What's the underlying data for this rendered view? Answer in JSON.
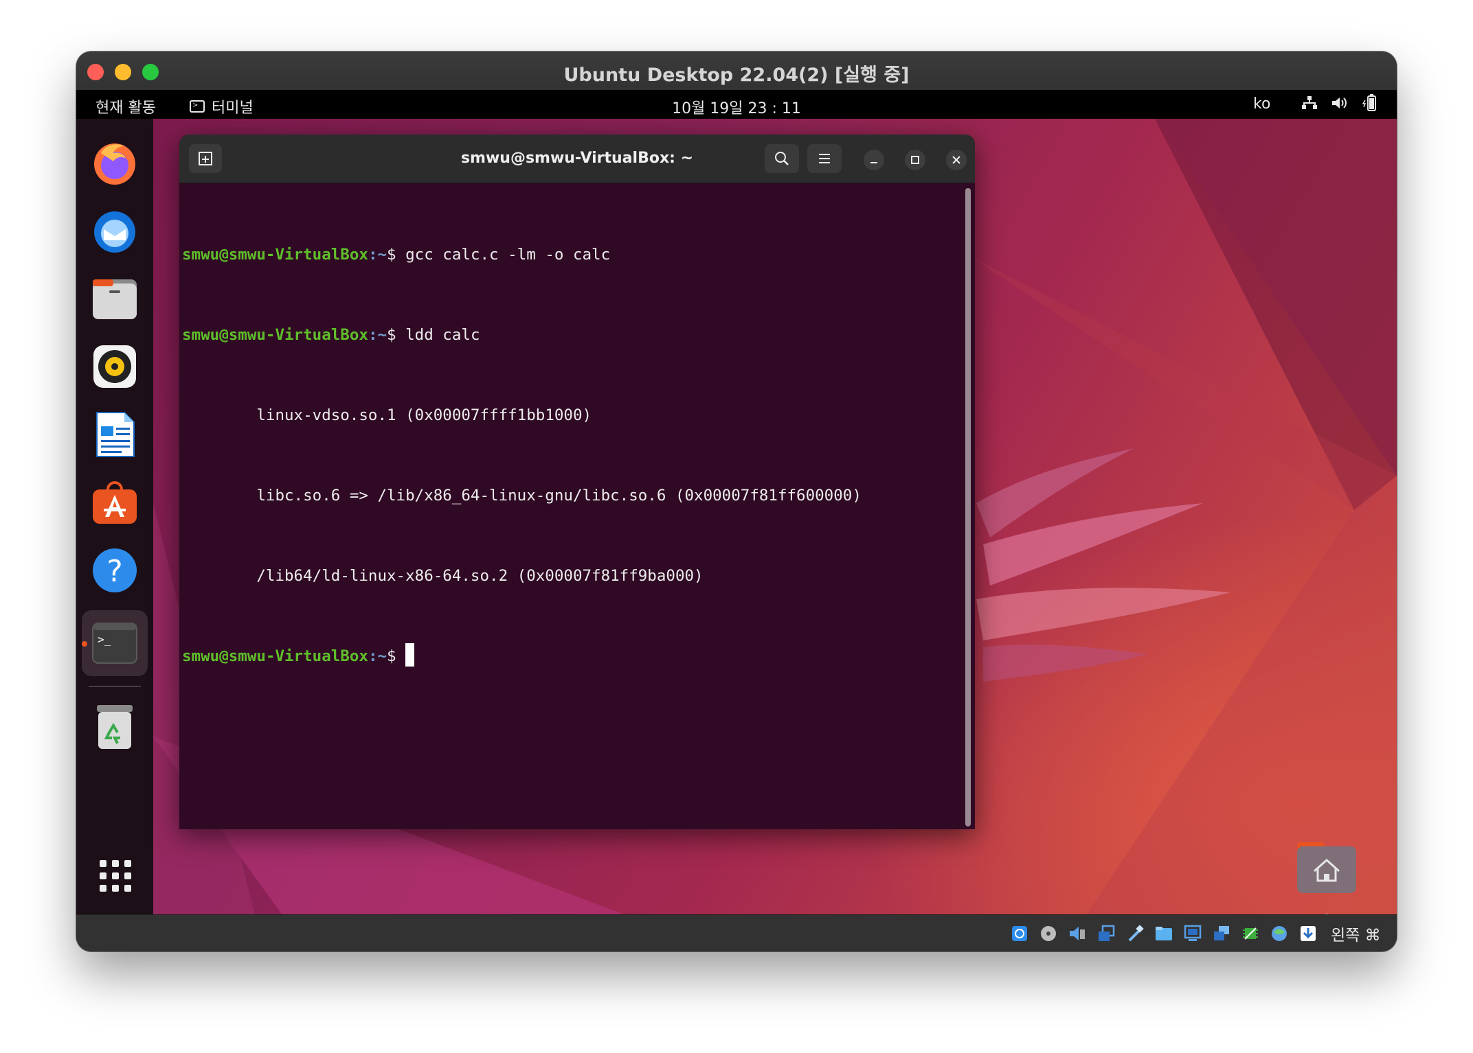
{
  "vm_window": {
    "title": "Ubuntu Desktop 22.04(2) [실행 중]"
  },
  "top_bar": {
    "activities": "현재 활동",
    "app_name": "터미널",
    "clock": "10월 19일  23 : 11",
    "input_lang": "ko"
  },
  "dock": {
    "items": [
      "firefox-icon",
      "thunderbird-icon",
      "files-icon",
      "rhythmbox-icon",
      "writer-icon",
      "software-icon",
      "help-icon",
      "terminal-icon",
      "trash-icon",
      "show-apps-icon"
    ]
  },
  "terminal": {
    "title": "smwu@smwu-VirtualBox: ~",
    "prompt_user": "smwu@smwu-VirtualBox",
    "prompt_path": ":~",
    "prompt_symbol": "$ ",
    "lines": [
      {
        "type": "cmd",
        "text": "gcc calc.c -lm -o calc"
      },
      {
        "type": "cmd",
        "text": "ldd calc"
      },
      {
        "type": "out",
        "text": "        linux-vdso.so.1 (0x00007ffff1bb1000)"
      },
      {
        "type": "out",
        "text": "        libc.so.6 => /lib/x86_64-linux-gnu/libc.so.6 (0x00007f81ff600000)"
      },
      {
        "type": "out",
        "text": "        /lib64/ld-linux-x86-64.so.2 (0x00007f81ff9ba000)"
      },
      {
        "type": "cmd",
        "text": ""
      }
    ]
  },
  "desktop": {
    "home_label": "홈"
  },
  "status_bar": {
    "host_key": "왼쪽 ⌘"
  },
  "colors": {
    "terminal_bg": "#300a24",
    "prompt_user": "#5fbf2a",
    "prompt_path": "#729fcf",
    "ubuntu_orange": "#e95420"
  }
}
